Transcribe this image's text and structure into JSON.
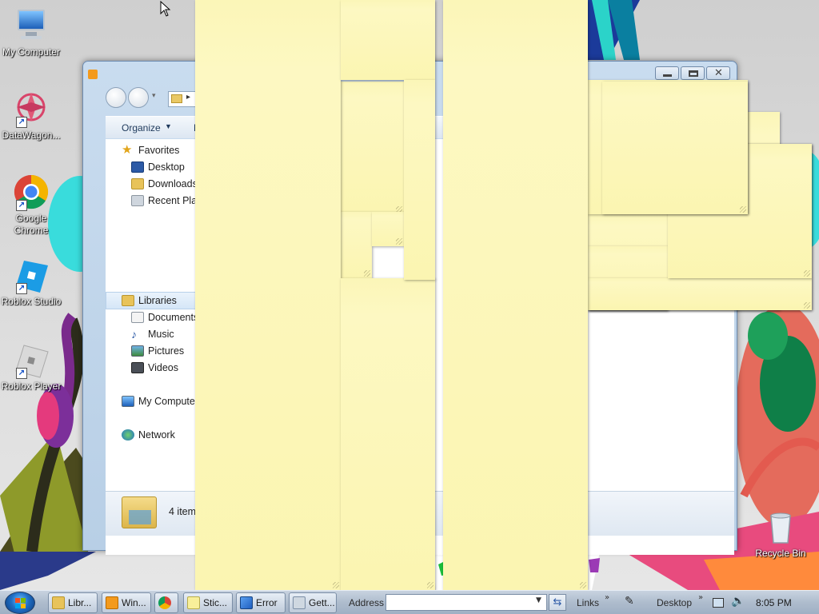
{
  "desktop": {
    "icons": [
      {
        "label": "My Computer",
        "icon": "computer-icon"
      },
      {
        "label": "DataWagon...",
        "icon": "datawagon-icon"
      },
      {
        "label": "Google Chrome",
        "icon": "chrome-icon"
      },
      {
        "label": "Roblox Studio",
        "icon": "roblox-studio-icon"
      },
      {
        "label": "Roblox Player",
        "icon": "roblox-player-icon"
      },
      {
        "label": "Recycle Bin",
        "icon": "recycle-bin-icon"
      }
    ]
  },
  "explorer": {
    "organize_label": "Organize",
    "nav": {
      "favorites": "Favorites",
      "desktop": "Desktop",
      "downloads": "Downloads",
      "recent_places": "Recent Places",
      "libraries": "Libraries",
      "documents": "Documents",
      "music": "Music",
      "pictures": "Pictures",
      "videos": "Videos",
      "my_computer": "My Computer",
      "network": "Network"
    },
    "details_count": "4 items"
  },
  "taskbar": {
    "buttons": [
      {
        "label": "Libr...",
        "icon": "folder-icon"
      },
      {
        "label": "Win...",
        "icon": "media-player-icon"
      },
      {
        "label": "",
        "icon": "chrome-icon"
      },
      {
        "label": "Stic...",
        "icon": "sticky-notes-icon"
      },
      {
        "label": "Error",
        "icon": "error-icon"
      },
      {
        "label": "Gett...",
        "icon": "getting-started-icon"
      }
    ],
    "address_label": "Address",
    "links_label": "Links",
    "desktop_label": "Desktop",
    "clock": "8:05 PM"
  },
  "colors": {
    "note": "#fbf5b1",
    "explorer_frame": "#c9dcef",
    "taskbar": "#aebccd"
  }
}
